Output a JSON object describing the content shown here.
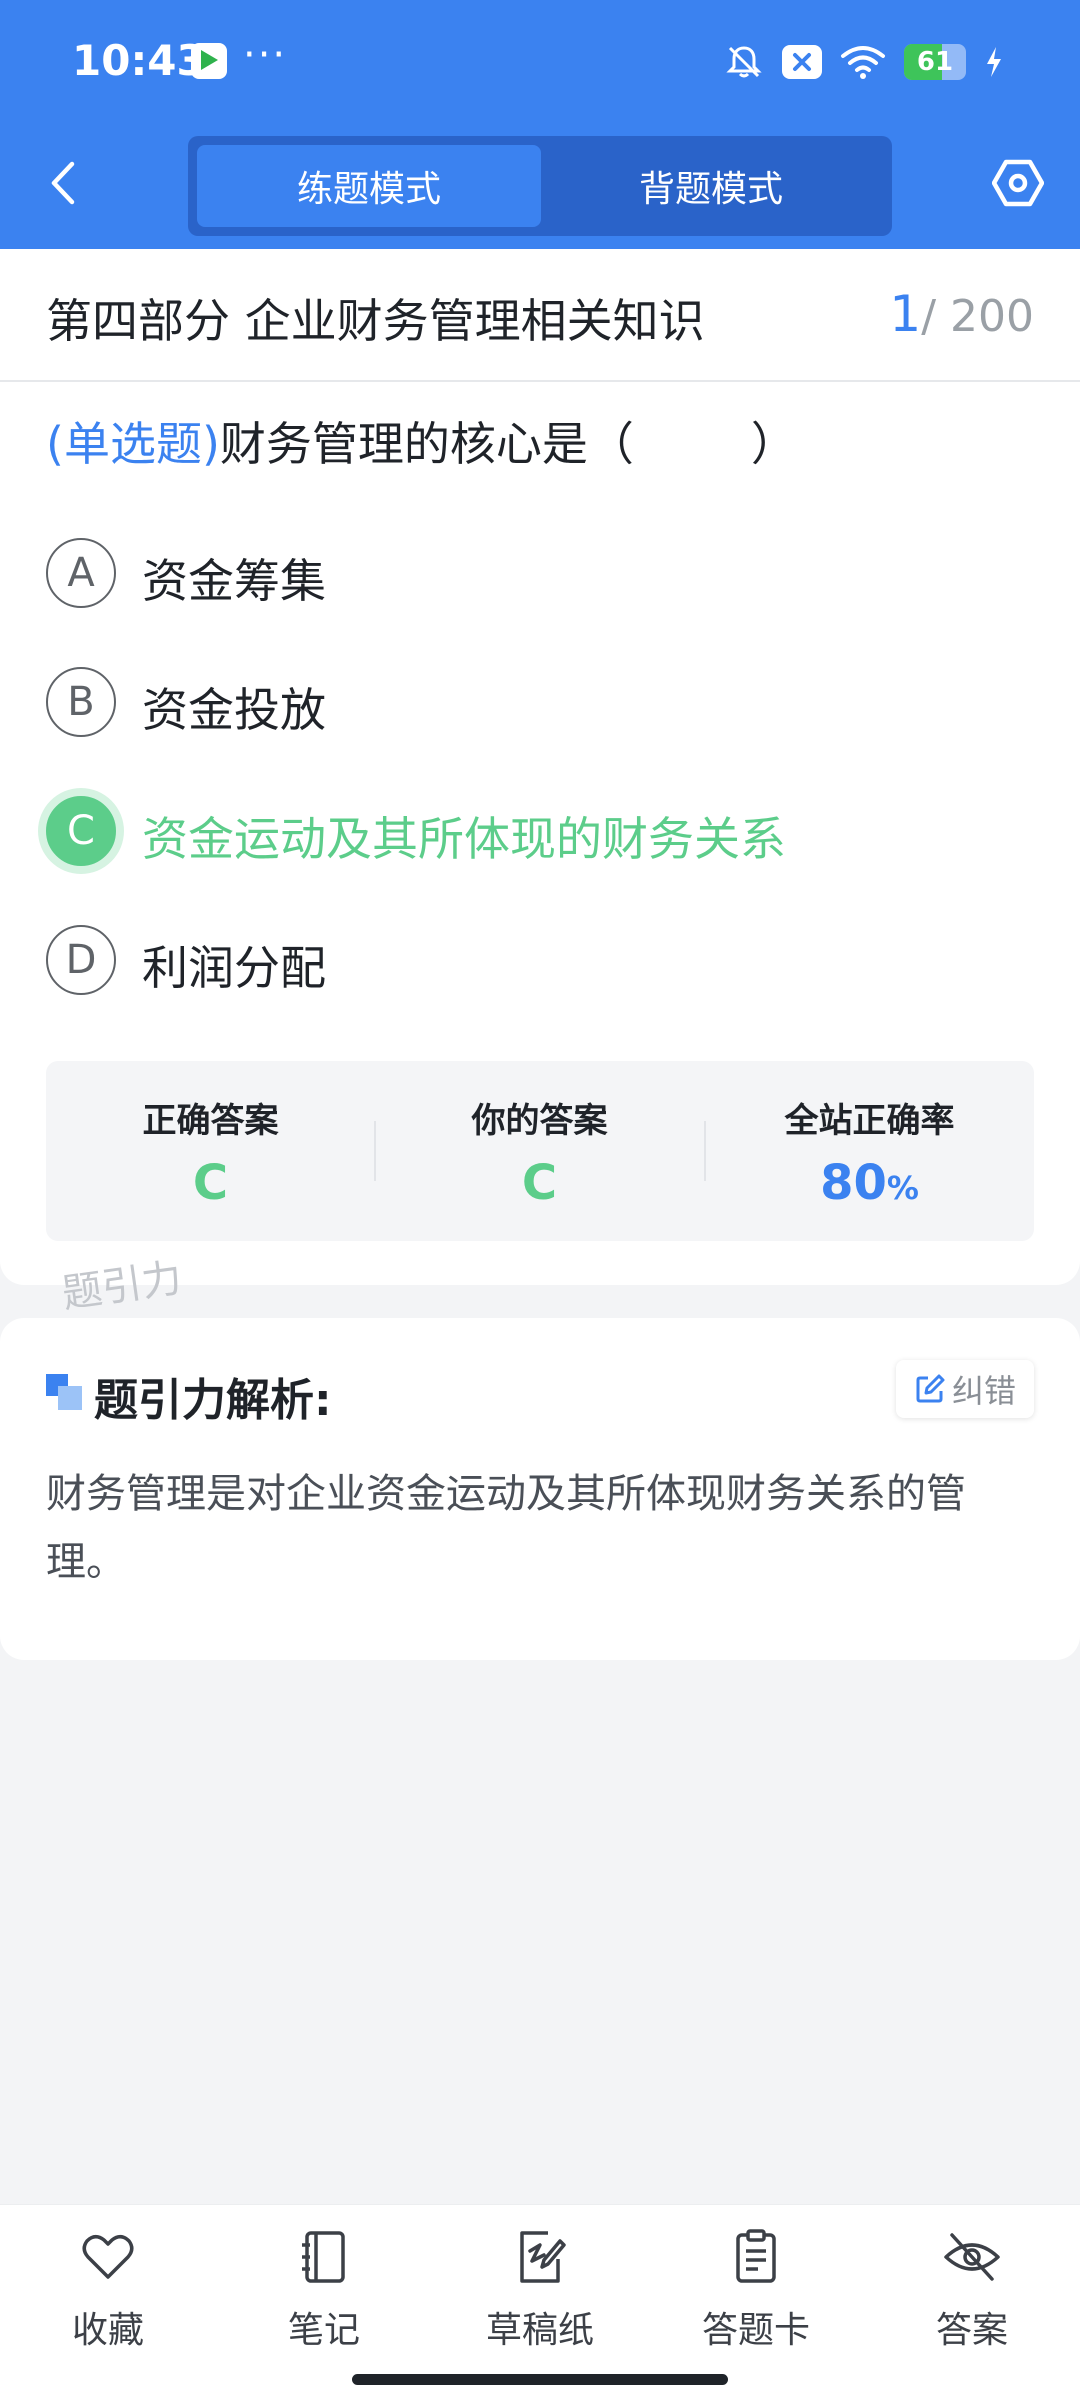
{
  "status_bar": {
    "time": "10:43",
    "more": "···",
    "battery": "61",
    "battery_level": 0.61
  },
  "nav": {
    "tabs": [
      "练题模式",
      "背题模式"
    ],
    "active_tab": 0
  },
  "section": {
    "title": "第四部分 企业财务管理相关知识",
    "current": "1",
    "total": "/ 200"
  },
  "question": {
    "type": "(单选题)",
    "text": "财务管理的核心是（        ）"
  },
  "options": [
    {
      "letter": "A",
      "text": "资金筹集",
      "correct": false
    },
    {
      "letter": "B",
      "text": "资金投放",
      "correct": false
    },
    {
      "letter": "C",
      "text": "资金运动及其所体现的财务关系",
      "correct": true
    },
    {
      "letter": "D",
      "text": "利润分配",
      "correct": false
    }
  ],
  "stats": {
    "correct_label": "正确答案",
    "correct_value": "C",
    "yours_label": "你的答案",
    "yours_value": "C",
    "rate_label": "全站正确率",
    "rate_value": "80",
    "rate_unit": "%"
  },
  "watermark": "题引力",
  "analysis": {
    "title": "题引力解析:",
    "report": "纠错",
    "text": "财务管理是对企业资金运动及其所体现财务关系的管理。"
  },
  "bottom_nav": [
    {
      "label": "收藏",
      "icon": "heart-icon"
    },
    {
      "label": "笔记",
      "icon": "notebook-icon"
    },
    {
      "label": "草稿纸",
      "icon": "draft-paper-icon"
    },
    {
      "label": "答题卡",
      "icon": "answer-sheet-icon"
    },
    {
      "label": "答案",
      "icon": "eye-off-icon"
    }
  ],
  "colors": {
    "primary": "#3b82f0",
    "correct": "#5ccd8a",
    "background": "#f3f4f6"
  }
}
